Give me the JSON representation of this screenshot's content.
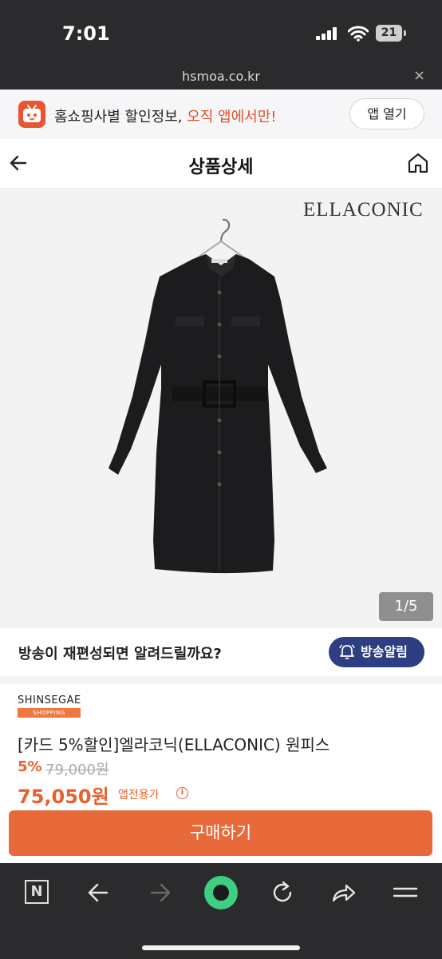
{
  "status": {
    "time": "7:01",
    "battery": "21"
  },
  "browser": {
    "url": "hsmoa.co.kr",
    "close_label": "×"
  },
  "banner": {
    "text_part1": "홈쇼핑사별 할인정보, ",
    "text_highlight": "오직 앱에서만!",
    "open_app_label": "앱 열기"
  },
  "header": {
    "title": "상품상세"
  },
  "gallery": {
    "brand_logo": "ELLACONIC",
    "counter": "1/5"
  },
  "notify": {
    "question": "방송이 재편성되면 알려드릴까요?",
    "button_label": "방송알림"
  },
  "product": {
    "seller": "SHINSEGAE",
    "seller_sub": "SHOPPING",
    "name": "[카드 5%할인]엘라코닉(ELLACONIC) 원피스",
    "discount": "5%",
    "original_price": "79,000원",
    "price": "75,050원",
    "app_only_label": "앱전용가",
    "info_icon_glyph": "i",
    "buy_label": "구매하기"
  },
  "toolbar": {
    "n_label": "N"
  },
  "colors": {
    "accent": "#e8693a",
    "notify_button": "#2d3e82",
    "brand_icon": "#e8552f",
    "green_button": "#3ecf82"
  }
}
